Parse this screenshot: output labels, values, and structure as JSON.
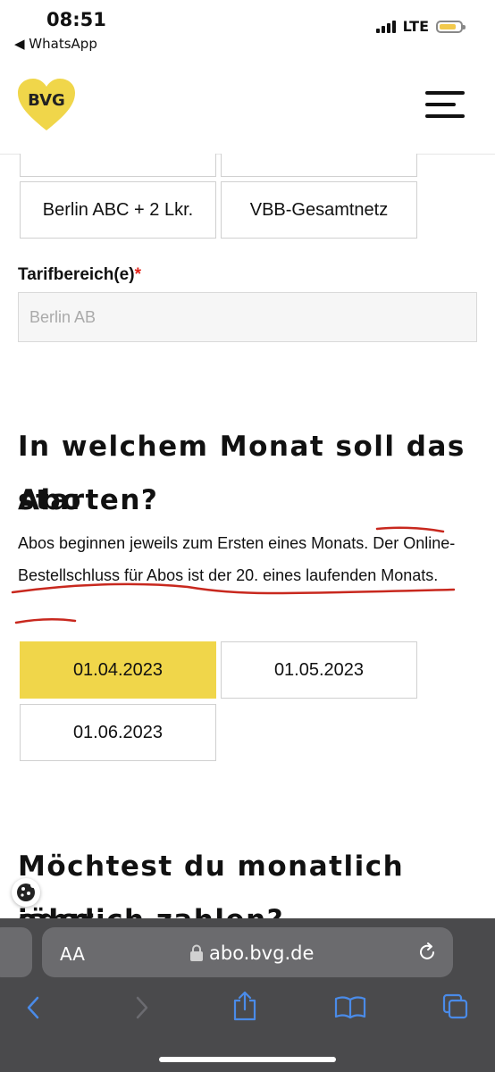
{
  "status_bar": {
    "time": "08:51",
    "back_app": "◀ WhatsApp",
    "network": "LTE"
  },
  "header": {
    "logo_text": "BVG",
    "logo_color": "#F0D64A"
  },
  "zone_options": {
    "items": [
      {
        "label": "Berlin ABC + 2 Lkr."
      },
      {
        "label": "VBB-Gesamtnetz"
      }
    ]
  },
  "tariff": {
    "label": "Tarifbereich(e)",
    "required_mark": "*",
    "value": "Berlin AB"
  },
  "start_month": {
    "heading_line1": "In welchem Monat soll das Abo",
    "heading_line2": "starten?",
    "description": "Abos beginnen jeweils zum Ersten eines Monats. Der Online-Bestellschluss für Abos ist der 20. eines laufenden Monats.",
    "dates": [
      {
        "label": "01.04.2023",
        "selected": true
      },
      {
        "label": "01.05.2023",
        "selected": false
      },
      {
        "label": "01.06.2023",
        "selected": false
      }
    ]
  },
  "payment": {
    "heading_line1": "Möchtest du monatlich oder",
    "heading_line2": "jährlich zahlen?"
  },
  "browser": {
    "aa_label": "AA",
    "url": "abo.bvg.de"
  },
  "colors": {
    "accent": "#F0D64A",
    "required": "#E2231A",
    "annotation": "#C8281E",
    "toolbar_icon": "#4A8BE8"
  }
}
